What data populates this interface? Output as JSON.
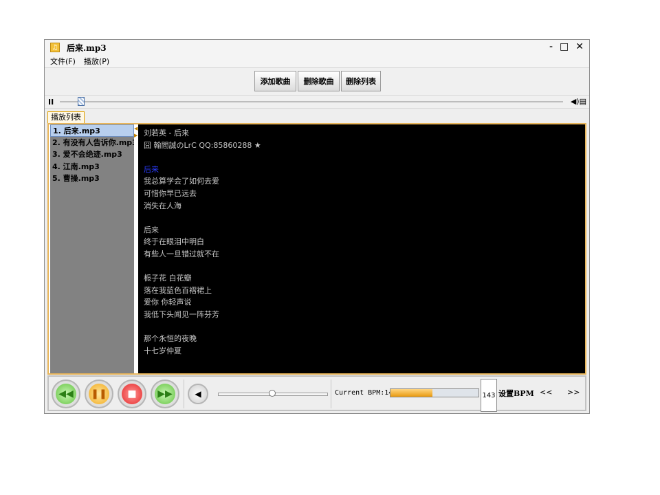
{
  "window": {
    "title": "后来.mp3",
    "controls": {
      "minimize": "-",
      "maximize": "□",
      "close": "✕"
    }
  },
  "menu": [
    "文件(F)",
    "播放(P)"
  ],
  "toolbar": {
    "add_song": "添加歌曲",
    "delete_song": "删除歌曲",
    "delete_list": "删除列表"
  },
  "tab": {
    "label": "播放列表"
  },
  "playlist": [
    "1. 后来.mp3",
    "2. 有没有人告诉你.mp3",
    "3. 爱不会绝迹.mp3",
    "4. 江南.mp3",
    "5. 曹操.mp3"
  ],
  "lyrics": [
    "刘若英 - 后来",
    "囧 翰閻誠のLrC QQ:85860288 ★",
    "",
    "后来",
    "我总算学会了如何去爱",
    "可惜你早已远去",
    "消失在人海",
    "",
    "后来",
    "终于在眼泪中明白",
    "有些人一旦错过就不在",
    "",
    "栀子花 白花瓣",
    "落在我蓝色百褶裙上",
    "爱你 你轻声说",
    "我低下头闻见一阵芬芳",
    "",
    "那个永恒的夜晚",
    "十七岁仲夏"
  ],
  "bpm": {
    "label": "Current BPM:143",
    "value": "143",
    "set_label": "设置BPM",
    "prev": "<<",
    "next": ">>",
    "level": 0.48
  },
  "colors": {
    "accent": "#e8b55a",
    "lyric_highlight": "#2b3cff"
  }
}
